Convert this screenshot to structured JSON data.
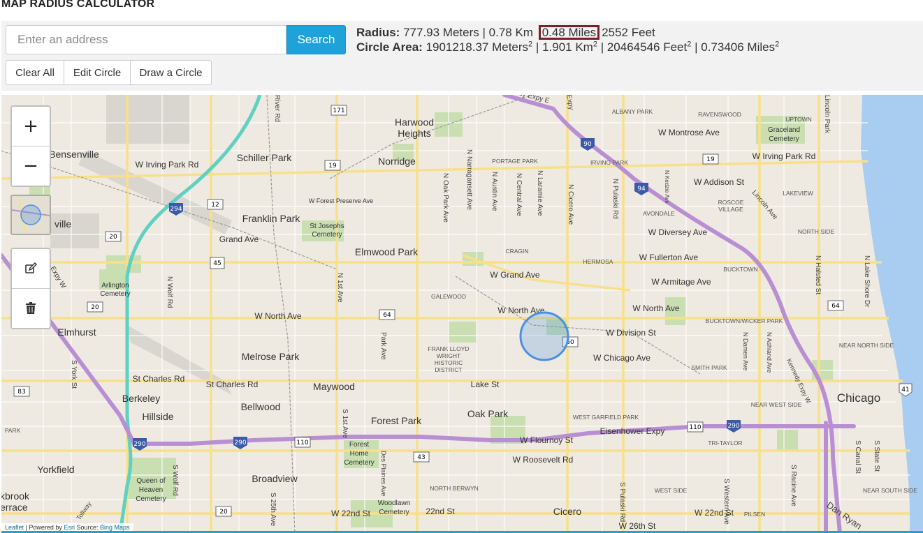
{
  "page": {
    "title": "MAP RADIUS CALCULATOR"
  },
  "search": {
    "placeholder": "Enter an address",
    "button_label": "Search"
  },
  "toolbar": {
    "clear_label": "Clear All",
    "edit_label": "Edit Circle",
    "draw_label": "Draw a Circle"
  },
  "results": {
    "radius_label": "Radius:",
    "radius_meters": "777.93 Meters",
    "radius_km": "0.78 Km",
    "radius_miles": "0.48 Miles",
    "radius_feet": "2552 Feet",
    "area_label": "Circle Area:",
    "area_meters": "1901218.37 Meters",
    "area_km": "1.901 Km",
    "area_feet": "20464546 Feet",
    "area_miles": "0.73406 Miles",
    "separator": "|",
    "sq": "2"
  },
  "map_controls": {
    "zoom_in": "+",
    "zoom_out": "−",
    "edit_icon": "edit-icon",
    "delete_icon": "trash-icon"
  },
  "attribution": {
    "leaflet": "Leaflet",
    "powered_by": "| Powered by",
    "esri": "Esri",
    "source": "Source:",
    "bing": "Bing Maps"
  },
  "colors": {
    "accent": "#1fa2d9",
    "highlight_border": "#7a1f2b",
    "map_land": "#efeae1",
    "lake": "#a8cdf0",
    "interstate": "#b98fd4",
    "tollway": "#5fd0c2",
    "circle": "#4a90e2"
  },
  "map": {
    "labels": [
      "Harwood Heights",
      "Norridge",
      "Schiller Park",
      "Bensenville",
      "Franklin Park",
      "Elmwood Park",
      "Grand Ave",
      "St Josephs Cemetery",
      "Arlington Cemetery",
      "Elmhurst",
      "Melrose Park",
      "St Charles Rd",
      "St Charles Rd",
      "Maywood",
      "Berkeley",
      "Hillside",
      "Bellwood",
      "Forest Park",
      "Oak Park",
      "Yorkfield",
      "Broadview",
      "Queen of Heaven Cemetery",
      "Forest Home Cemetery",
      "Woodlawn Cemetery",
      "Chicago",
      "Cicero",
      "W North Ave",
      "W North Ave",
      "W North Ave",
      "W Division St",
      "W Chicago Ave",
      "Lake St",
      "W Grand Ave",
      "W Fullerton Ave",
      "W Armitage Ave",
      "W Diversey Ave",
      "W Addison St",
      "W Montrose Ave",
      "W Irving Park Rd",
      "W Irving Park Rd",
      "Eisenhower Expy",
      "W Flournoy St",
      "W Roosevelt Rd",
      "W 22nd St",
      "22nd St",
      "W 22nd St",
      "W 26th St",
      "W Forest Preserve Ave",
      "FRANK LLOYD WRIGHT HISTORIC DISTRICT",
      "GALEWOOD",
      "CRAGIN",
      "HERMOSA",
      "AVONDALE",
      "ALBANY PARK",
      "RAVENSWOOD",
      "UPTOWN",
      "Graceland Cemetery",
      "LAKEVIEW",
      "ROSCOE VILLAGE",
      "NORTH SIDE",
      "BUCKTOWN",
      "BUCKTOWN/WICKER PARK",
      "NEAR NORTH SIDE",
      "SMITH PARK",
      "NEAR WEST SIDE",
      "WEST GARFIELD PARK",
      "TRI-TAYLOR",
      "NORTH BERWYN",
      "WEST SIDE",
      "PILSEN",
      "NEAR SOUTH SIDE",
      "PORTAGE PARK",
      "IRVING PARK",
      "N Cicero Ave",
      "N Pulaski Rd",
      "N Narragansett Ave",
      "N Oak Park Ave",
      "N Austin Ave",
      "N Central Ave",
      "N Laramie Ave",
      "N Kedzie Ave",
      "N Halsted St",
      "N Lake Shore Dr",
      "Lincoln Ave",
      "Kennedy Expy W",
      "Dan Ryan",
      "River Rd",
      "N Wolf Rd",
      "N 1st Ave",
      "Park Ave",
      "S York St",
      "S Wolf Rd",
      "S 1st Ave",
      "S 25th Ave",
      "Des Plaines Ave",
      "S Pulaski Rd",
      "S Western Ave",
      "S Canal St",
      "S State St",
      "S Racine Ave",
      "N Damen Ave",
      "N Ashland Ave",
      "ville",
      "kbrook",
      "errace",
      "PARK",
      "Expy W",
      "Expy",
      "Lincoln Park",
      "Tollway",
      "Dan Ryan"
    ],
    "shields": [
      "171",
      "19",
      "12",
      "294",
      "20",
      "45",
      "20",
      "64",
      "90",
      "94",
      "19",
      "64",
      "50",
      "83",
      "290",
      "290",
      "110",
      "43",
      "20",
      "110",
      "290",
      "41"
    ]
  }
}
